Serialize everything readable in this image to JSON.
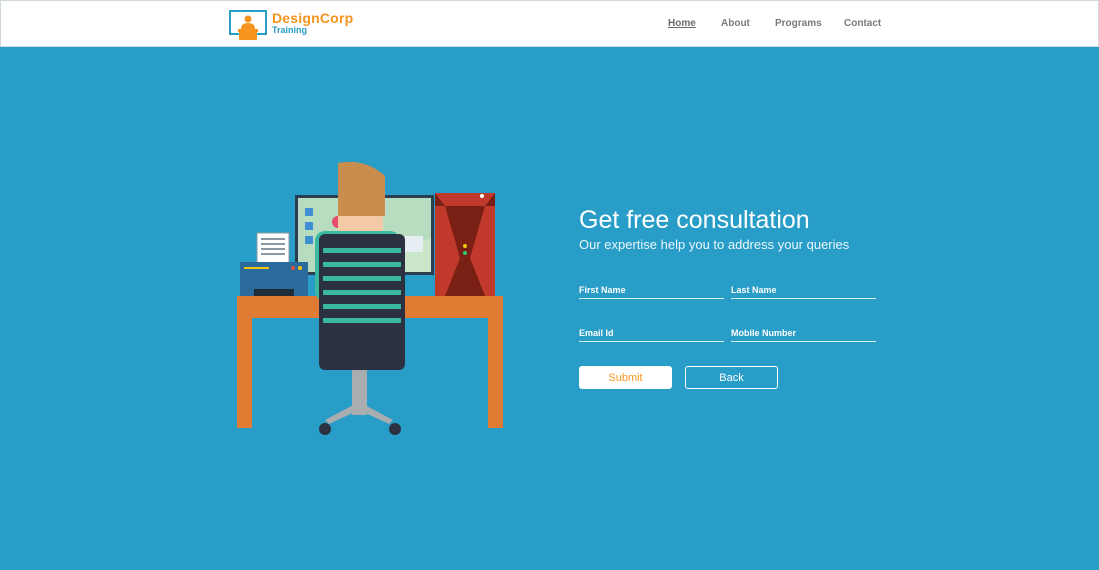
{
  "brand": {
    "name": "DesignCorp",
    "tagline": "Training",
    "icon": "presenter-at-screen-icon"
  },
  "nav": {
    "items": [
      {
        "label": "Home",
        "active": true
      },
      {
        "label": "About",
        "active": false
      },
      {
        "label": "Programs",
        "active": false
      },
      {
        "label": "Contact",
        "active": false
      }
    ]
  },
  "hero": {
    "illustration": "person-at-computer-desk-illustration",
    "title": "Get free consultation",
    "subtitle": "Our expertise help you to address your queries"
  },
  "form": {
    "first_name_placeholder": "First Name",
    "last_name_placeholder": "Last Name",
    "email_placeholder": "Email Id",
    "mobile_placeholder": "Mobile Number",
    "submit_label": "Submit",
    "back_label": "Back"
  },
  "colors": {
    "background": "#289dc7",
    "accent": "#f7941d",
    "header": "#ffffff"
  }
}
